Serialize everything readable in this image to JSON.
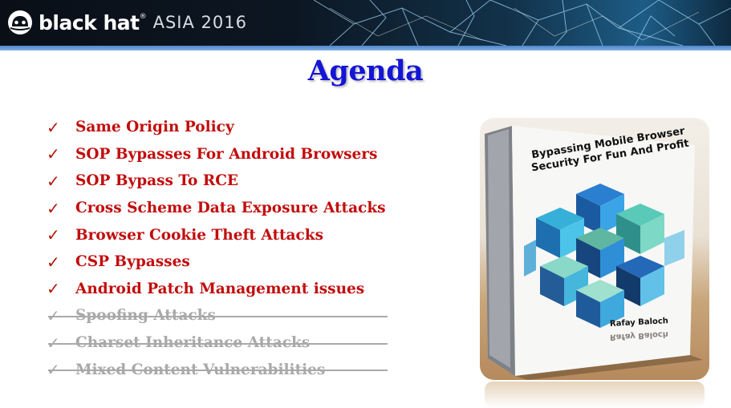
{
  "header": {
    "brand": "black hat",
    "trademark": "®",
    "event": "ASIA 2016",
    "logo_icon": "black-hat-logo-icon"
  },
  "slide": {
    "title": "Agenda",
    "items": [
      {
        "label": "Same Origin Policy",
        "done": false
      },
      {
        "label": "SOP Bypasses For Android Browsers",
        "done": false
      },
      {
        "label": "SOP Bypass To RCE",
        "done": false
      },
      {
        "label": "Cross Scheme Data Exposure Attacks",
        "done": false
      },
      {
        "label": "Browser Cookie Theft Attacks",
        "done": false
      },
      {
        "label": "CSP Bypasses",
        "done": false
      },
      {
        "label": "Android Patch Management issues",
        "done": false
      },
      {
        "label": "Spoofing Attacks",
        "done": true
      },
      {
        "label": "Charset Inheritance Attacks",
        "done": true
      },
      {
        "label": "Mixed Content Vulnerabilities",
        "done": true
      }
    ],
    "check_glyph": "✓"
  },
  "book": {
    "title": "Bypassing Mobile Browser Security For Fun And Profit",
    "author": "Rafay Baloch"
  },
  "colors": {
    "title": "#1515d6",
    "item": "#c20d0d",
    "struck": "#a9a9a9",
    "stripe": "#4f86c7"
  }
}
